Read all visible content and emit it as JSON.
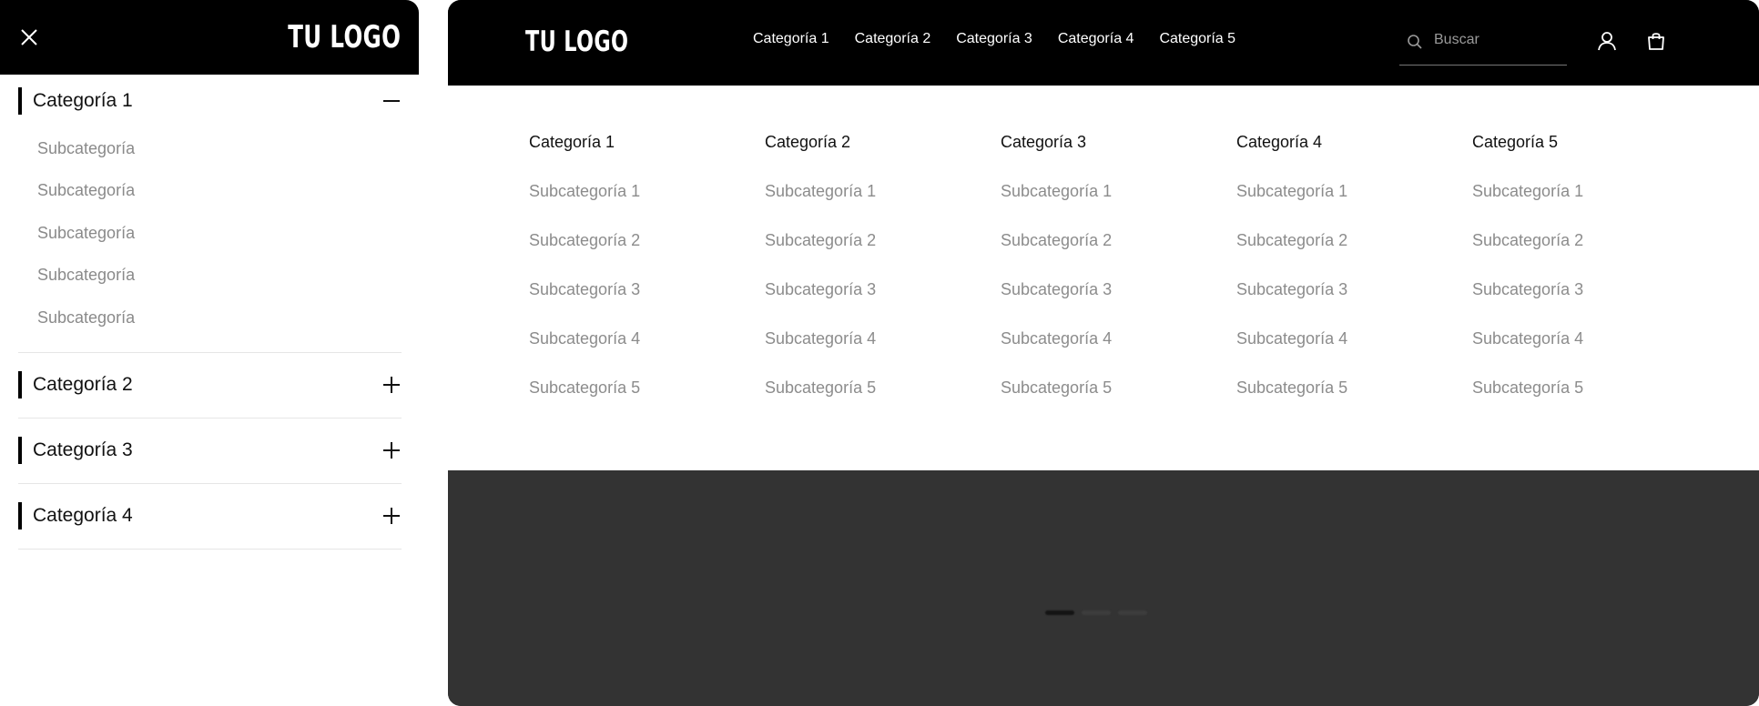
{
  "mobile": {
    "logo": "TU LOGO",
    "categories": [
      {
        "label": "Categoría 1",
        "expanded": true,
        "subcategories": [
          "Subcategoría",
          "Subcategoría",
          "Subcategoría",
          "Subcategoría",
          "Subcategoría"
        ]
      },
      {
        "label": "Categoría 2",
        "expanded": false
      },
      {
        "label": "Categoría 3",
        "expanded": false
      },
      {
        "label": "Categoría 4",
        "expanded": false
      }
    ]
  },
  "desktop": {
    "logo": "TU LOGO",
    "nav": [
      "Categoría 1",
      "Categoría 2",
      "Categoría 3",
      "Categoría 4",
      "Categoría 5"
    ],
    "search": {
      "placeholder": "Buscar"
    },
    "mega_menu": [
      {
        "title": "Categoría 1",
        "links": [
          "Subcategoría 1",
          "Subcategoría 2",
          "Subcategoría 3",
          "Subcategoría 4",
          "Subcategoría 5"
        ]
      },
      {
        "title": "Categoría 2",
        "links": [
          "Subcategoría 1",
          "Subcategoría 2",
          "Subcategoría 3",
          "Subcategoría 4",
          "Subcategoría 5"
        ]
      },
      {
        "title": "Categoría 3",
        "links": [
          "Subcategoría 1",
          "Subcategoría 2",
          "Subcategoría 3",
          "Subcategoría 4",
          "Subcategoría 5"
        ]
      },
      {
        "title": "Categoría 4",
        "links": [
          "Subcategoría 1",
          "Subcategoría 2",
          "Subcategoría 3",
          "Subcategoría 4",
          "Subcategoría 5"
        ]
      },
      {
        "title": "Categoría 5",
        "links": [
          "Subcategoría 1",
          "Subcategoría 2",
          "Subcategoría 3",
          "Subcategoría 4",
          "Subcategoría 5"
        ]
      }
    ],
    "carousel": {
      "slide_count": 3,
      "active_index": 0
    }
  },
  "colors": {
    "header_bg": "#000000",
    "hero_bg": "#333333",
    "muted_text": "#8c8c8c"
  },
  "icons": [
    "close-icon",
    "search-icon",
    "user-icon",
    "shopping-bag-icon",
    "minus-icon",
    "plus-icon"
  ]
}
